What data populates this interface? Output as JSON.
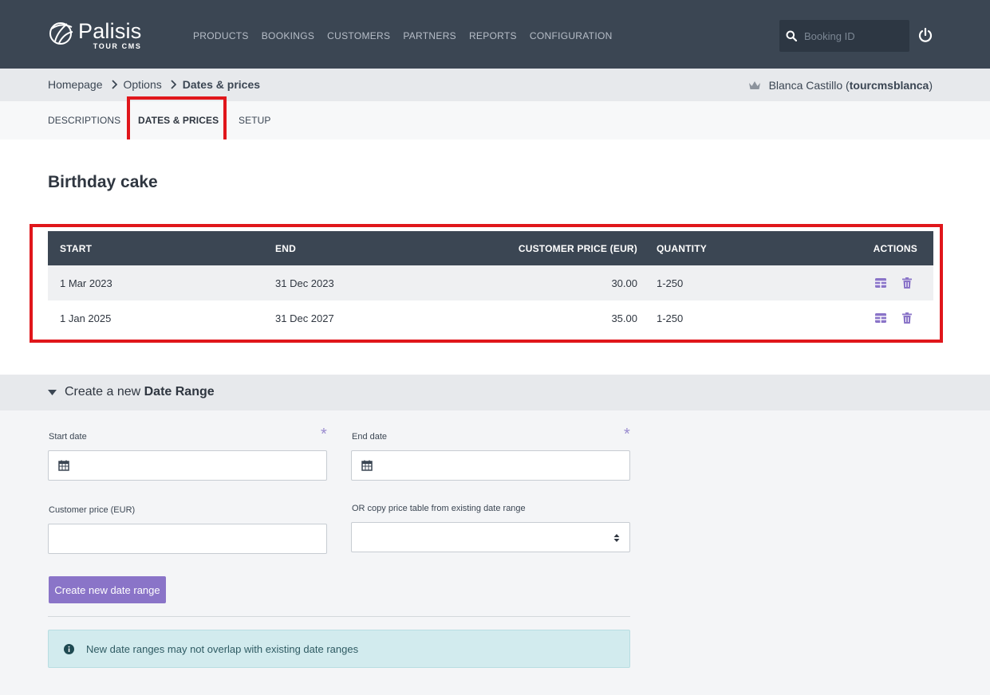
{
  "brand": {
    "name": "Palisis",
    "sub": "TOUR CMS"
  },
  "nav": [
    "PRODUCTS",
    "BOOKINGS",
    "CUSTOMERS",
    "PARTNERS",
    "REPORTS",
    "CONFIGURATION"
  ],
  "search": {
    "placeholder": "Booking ID"
  },
  "breadcrumb": {
    "items": [
      "Homepage",
      "Options"
    ],
    "current": "Dates & prices"
  },
  "user": {
    "name": "Blanca Castillo",
    "login": "tourcmsblanca"
  },
  "tabs": [
    "DESCRIPTIONS",
    "DATES & PRICES",
    "SETUP"
  ],
  "page_title": "Birthday cake",
  "table": {
    "headers": [
      "START",
      "END",
      "CUSTOMER PRICE (EUR)",
      "QUANTITY",
      "ACTIONS"
    ],
    "rows": [
      {
        "start": "1 Mar 2023",
        "end": "31 Dec 2023",
        "price": "30.00",
        "quantity": "1-250"
      },
      {
        "start": "1 Jan 2025",
        "end": "31 Dec 2027",
        "price": "35.00",
        "quantity": "1-250"
      }
    ]
  },
  "create": {
    "prefix": "Create a new",
    "title": "Date Range",
    "start_label": "Start date",
    "end_label": "End date",
    "price_label": "Customer price (EUR)",
    "copy_label": "OR copy price table from existing date range",
    "required_mark": "*",
    "button": "Create new date range",
    "notice": "New date ranges may not overlap with existing date ranges"
  },
  "colors": {
    "topbar": "#3b4653",
    "accent": "#8a74c8",
    "highlight": "#e0161b"
  }
}
